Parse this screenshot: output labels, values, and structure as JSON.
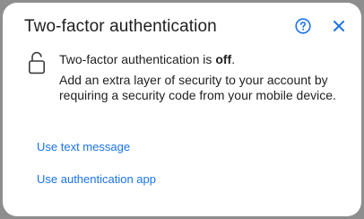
{
  "dialog": {
    "title": "Two-factor authentication",
    "help_icon": "help-circle-icon",
    "close_icon": "close-icon",
    "status_prefix": "Two-factor authentication is ",
    "status_value": "off",
    "status_suffix": ".",
    "description": "Add an extra layer of security to your account by requiring a security code from your mobile device.",
    "lock_icon": "unlocked-padlock-icon",
    "options": [
      {
        "label": "Use text message"
      },
      {
        "label": "Use authentication app"
      }
    ]
  },
  "colors": {
    "accent": "#1a73e8",
    "text": "#1f1f1f",
    "backdrop": "#8e8e8e"
  }
}
